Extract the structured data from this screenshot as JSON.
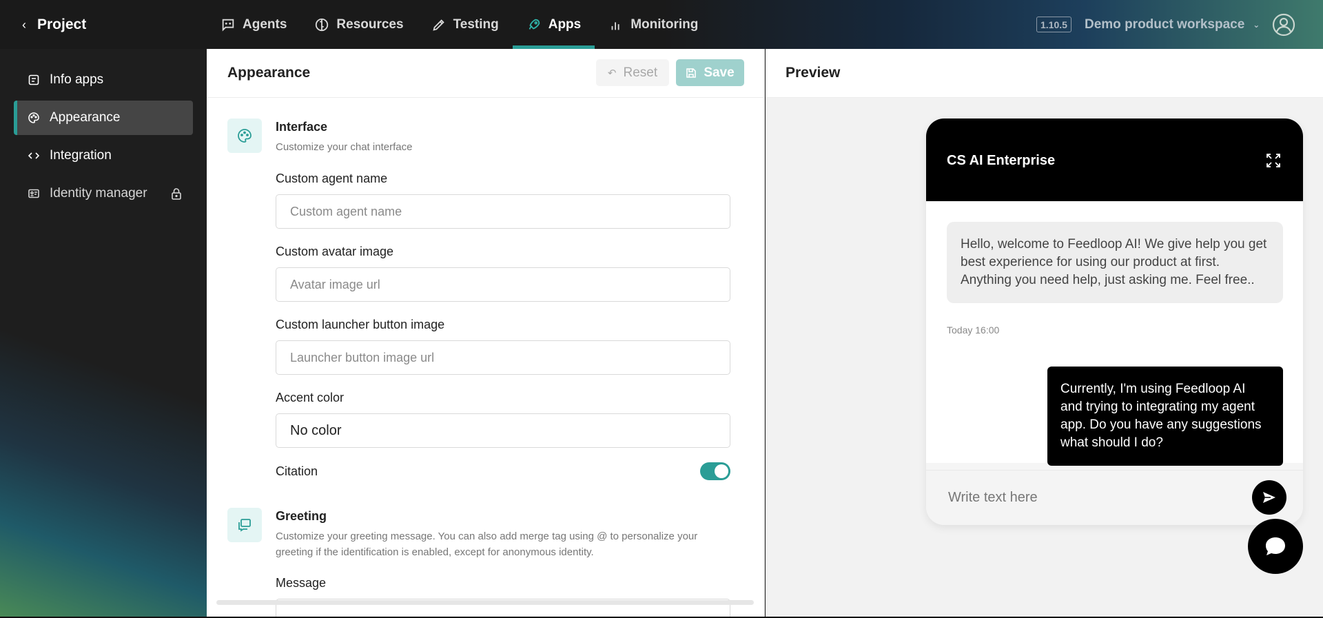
{
  "header": {
    "back_label": "Project",
    "nav": [
      {
        "label": "Agents",
        "icon": "chat-icon"
      },
      {
        "label": "Resources",
        "icon": "book-icon"
      },
      {
        "label": "Testing",
        "icon": "pencil-icon"
      },
      {
        "label": "Apps",
        "icon": "rocket-icon"
      },
      {
        "label": "Monitoring",
        "icon": "bar-chart-icon"
      }
    ],
    "active_nav": "Apps",
    "version": "1.10.5",
    "workspace": "Demo product workspace"
  },
  "sidebar": {
    "items": [
      {
        "label": "Info apps",
        "icon": "document-icon"
      },
      {
        "label": "Appearance",
        "icon": "palette-icon"
      },
      {
        "label": "Integration",
        "icon": "code-icon"
      },
      {
        "label": "Identity manager",
        "icon": "id-card-icon",
        "locked": true
      }
    ],
    "active": "Appearance"
  },
  "panel": {
    "title": "Appearance",
    "reset_label": "Reset",
    "save_label": "Save",
    "interface": {
      "title": "Interface",
      "description": "Customize your chat interface"
    },
    "fields": {
      "agent_name_label": "Custom agent name",
      "agent_name_placeholder": "Custom agent name",
      "avatar_label": "Custom avatar image",
      "avatar_placeholder": "Avatar image url",
      "launcher_label": "Custom launcher button image",
      "launcher_placeholder": "Launcher button image url",
      "accent_label": "Accent color",
      "accent_value": "No color",
      "citation_label": "Citation",
      "citation_enabled": true
    },
    "greeting": {
      "title": "Greeting",
      "description": "Customize your greeting message. You can also add merge tag using @ to personalize your greeting if the identification is enabled, except for anonymous identity.",
      "message_label": "Message"
    }
  },
  "preview": {
    "title": "Preview",
    "widget_title": "CS AI Enterprise",
    "bot_message": "Hello, welcome to Feedloop AI! We give help you get best experience for using our product at first. Anything you need help, just asking me. Feel free..",
    "bot_time": "Today 16:00",
    "user_message": "Currently, I'm using Feedloop AI and trying to integrating my agent app. Do you have any suggestions what should I do?",
    "input_placeholder": "Write text here"
  },
  "colors": {
    "accent": "#2a9d96",
    "save_disabled": "#9fd1cd",
    "widget_header": "#000000"
  }
}
